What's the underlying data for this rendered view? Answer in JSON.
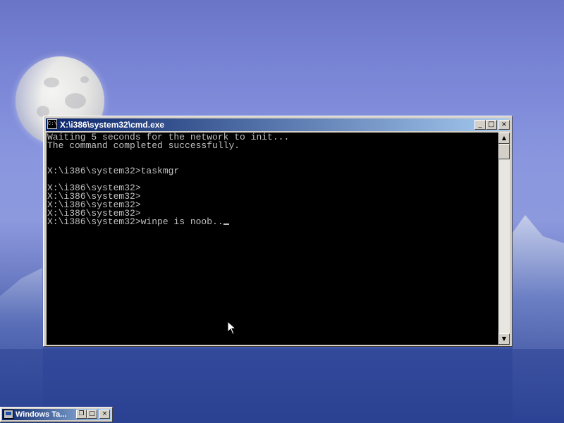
{
  "window": {
    "title": "X:\\i386\\system32\\cmd.exe",
    "icon": "cmd-icon",
    "icon_glyph": "C:\\",
    "buttons": {
      "minimize": "_",
      "maximize": "□",
      "close": "×"
    }
  },
  "console": {
    "lines": [
      "Waiting 5 seconds for the network to init...",
      "The command completed successfully.",
      "",
      "",
      "X:\\i386\\system32>taskmgr",
      "",
      "X:\\i386\\system32>",
      "X:\\i386\\system32>",
      "X:\\i386\\system32>",
      "X:\\i386\\system32>",
      "X:\\i386\\system32>winpe is noob.."
    ],
    "text_color": "#c0c0c0",
    "background": "#000000"
  },
  "scrollbar": {
    "up_arrow": "▲",
    "down_arrow": "▼"
  },
  "minimized_window": {
    "title": "Windows Ta...",
    "icon": "computer-icon",
    "buttons": {
      "restore": "❐",
      "maximize": "□",
      "close": "×"
    }
  },
  "colors": {
    "title_bar_start": "#0a246a",
    "title_bar_end": "#a6caf0",
    "window_face": "#d4d0c8",
    "desktop_sky": "#7a86d6"
  }
}
